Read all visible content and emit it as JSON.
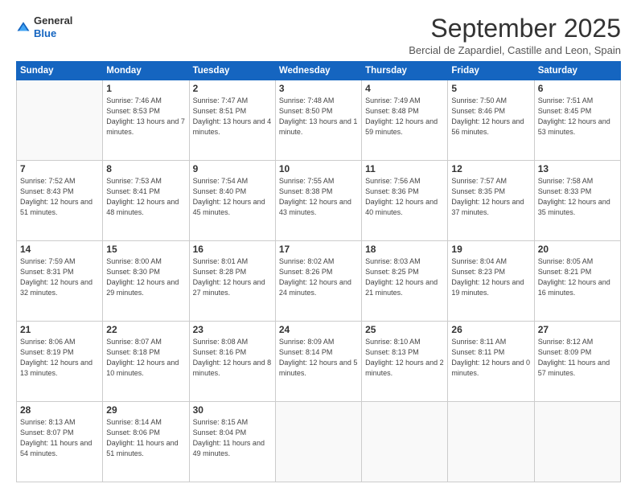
{
  "logo": {
    "text_general": "General",
    "text_blue": "Blue"
  },
  "header": {
    "month_title": "September 2025",
    "location": "Bercial de Zapardiel, Castille and Leon, Spain"
  },
  "weekdays": [
    "Sunday",
    "Monday",
    "Tuesday",
    "Wednesday",
    "Thursday",
    "Friday",
    "Saturday"
  ],
  "weeks": [
    [
      {
        "day": "",
        "sunrise": "",
        "sunset": "",
        "daylight": ""
      },
      {
        "day": "1",
        "sunrise": "Sunrise: 7:46 AM",
        "sunset": "Sunset: 8:53 PM",
        "daylight": "Daylight: 13 hours and 7 minutes."
      },
      {
        "day": "2",
        "sunrise": "Sunrise: 7:47 AM",
        "sunset": "Sunset: 8:51 PM",
        "daylight": "Daylight: 13 hours and 4 minutes."
      },
      {
        "day": "3",
        "sunrise": "Sunrise: 7:48 AM",
        "sunset": "Sunset: 8:50 PM",
        "daylight": "Daylight: 13 hours and 1 minute."
      },
      {
        "day": "4",
        "sunrise": "Sunrise: 7:49 AM",
        "sunset": "Sunset: 8:48 PM",
        "daylight": "Daylight: 12 hours and 59 minutes."
      },
      {
        "day": "5",
        "sunrise": "Sunrise: 7:50 AM",
        "sunset": "Sunset: 8:46 PM",
        "daylight": "Daylight: 12 hours and 56 minutes."
      },
      {
        "day": "6",
        "sunrise": "Sunrise: 7:51 AM",
        "sunset": "Sunset: 8:45 PM",
        "daylight": "Daylight: 12 hours and 53 minutes."
      }
    ],
    [
      {
        "day": "7",
        "sunrise": "Sunrise: 7:52 AM",
        "sunset": "Sunset: 8:43 PM",
        "daylight": "Daylight: 12 hours and 51 minutes."
      },
      {
        "day": "8",
        "sunrise": "Sunrise: 7:53 AM",
        "sunset": "Sunset: 8:41 PM",
        "daylight": "Daylight: 12 hours and 48 minutes."
      },
      {
        "day": "9",
        "sunrise": "Sunrise: 7:54 AM",
        "sunset": "Sunset: 8:40 PM",
        "daylight": "Daylight: 12 hours and 45 minutes."
      },
      {
        "day": "10",
        "sunrise": "Sunrise: 7:55 AM",
        "sunset": "Sunset: 8:38 PM",
        "daylight": "Daylight: 12 hours and 43 minutes."
      },
      {
        "day": "11",
        "sunrise": "Sunrise: 7:56 AM",
        "sunset": "Sunset: 8:36 PM",
        "daylight": "Daylight: 12 hours and 40 minutes."
      },
      {
        "day": "12",
        "sunrise": "Sunrise: 7:57 AM",
        "sunset": "Sunset: 8:35 PM",
        "daylight": "Daylight: 12 hours and 37 minutes."
      },
      {
        "day": "13",
        "sunrise": "Sunrise: 7:58 AM",
        "sunset": "Sunset: 8:33 PM",
        "daylight": "Daylight: 12 hours and 35 minutes."
      }
    ],
    [
      {
        "day": "14",
        "sunrise": "Sunrise: 7:59 AM",
        "sunset": "Sunset: 8:31 PM",
        "daylight": "Daylight: 12 hours and 32 minutes."
      },
      {
        "day": "15",
        "sunrise": "Sunrise: 8:00 AM",
        "sunset": "Sunset: 8:30 PM",
        "daylight": "Daylight: 12 hours and 29 minutes."
      },
      {
        "day": "16",
        "sunrise": "Sunrise: 8:01 AM",
        "sunset": "Sunset: 8:28 PM",
        "daylight": "Daylight: 12 hours and 27 minutes."
      },
      {
        "day": "17",
        "sunrise": "Sunrise: 8:02 AM",
        "sunset": "Sunset: 8:26 PM",
        "daylight": "Daylight: 12 hours and 24 minutes."
      },
      {
        "day": "18",
        "sunrise": "Sunrise: 8:03 AM",
        "sunset": "Sunset: 8:25 PM",
        "daylight": "Daylight: 12 hours and 21 minutes."
      },
      {
        "day": "19",
        "sunrise": "Sunrise: 8:04 AM",
        "sunset": "Sunset: 8:23 PM",
        "daylight": "Daylight: 12 hours and 19 minutes."
      },
      {
        "day": "20",
        "sunrise": "Sunrise: 8:05 AM",
        "sunset": "Sunset: 8:21 PM",
        "daylight": "Daylight: 12 hours and 16 minutes."
      }
    ],
    [
      {
        "day": "21",
        "sunrise": "Sunrise: 8:06 AM",
        "sunset": "Sunset: 8:19 PM",
        "daylight": "Daylight: 12 hours and 13 minutes."
      },
      {
        "day": "22",
        "sunrise": "Sunrise: 8:07 AM",
        "sunset": "Sunset: 8:18 PM",
        "daylight": "Daylight: 12 hours and 10 minutes."
      },
      {
        "day": "23",
        "sunrise": "Sunrise: 8:08 AM",
        "sunset": "Sunset: 8:16 PM",
        "daylight": "Daylight: 12 hours and 8 minutes."
      },
      {
        "day": "24",
        "sunrise": "Sunrise: 8:09 AM",
        "sunset": "Sunset: 8:14 PM",
        "daylight": "Daylight: 12 hours and 5 minutes."
      },
      {
        "day": "25",
        "sunrise": "Sunrise: 8:10 AM",
        "sunset": "Sunset: 8:13 PM",
        "daylight": "Daylight: 12 hours and 2 minutes."
      },
      {
        "day": "26",
        "sunrise": "Sunrise: 8:11 AM",
        "sunset": "Sunset: 8:11 PM",
        "daylight": "Daylight: 12 hours and 0 minutes."
      },
      {
        "day": "27",
        "sunrise": "Sunrise: 8:12 AM",
        "sunset": "Sunset: 8:09 PM",
        "daylight": "Daylight: 11 hours and 57 minutes."
      }
    ],
    [
      {
        "day": "28",
        "sunrise": "Sunrise: 8:13 AM",
        "sunset": "Sunset: 8:07 PM",
        "daylight": "Daylight: 11 hours and 54 minutes."
      },
      {
        "day": "29",
        "sunrise": "Sunrise: 8:14 AM",
        "sunset": "Sunset: 8:06 PM",
        "daylight": "Daylight: 11 hours and 51 minutes."
      },
      {
        "day": "30",
        "sunrise": "Sunrise: 8:15 AM",
        "sunset": "Sunset: 8:04 PM",
        "daylight": "Daylight: 11 hours and 49 minutes."
      },
      {
        "day": "",
        "sunrise": "",
        "sunset": "",
        "daylight": ""
      },
      {
        "day": "",
        "sunrise": "",
        "sunset": "",
        "daylight": ""
      },
      {
        "day": "",
        "sunrise": "",
        "sunset": "",
        "daylight": ""
      },
      {
        "day": "",
        "sunrise": "",
        "sunset": "",
        "daylight": ""
      }
    ]
  ]
}
